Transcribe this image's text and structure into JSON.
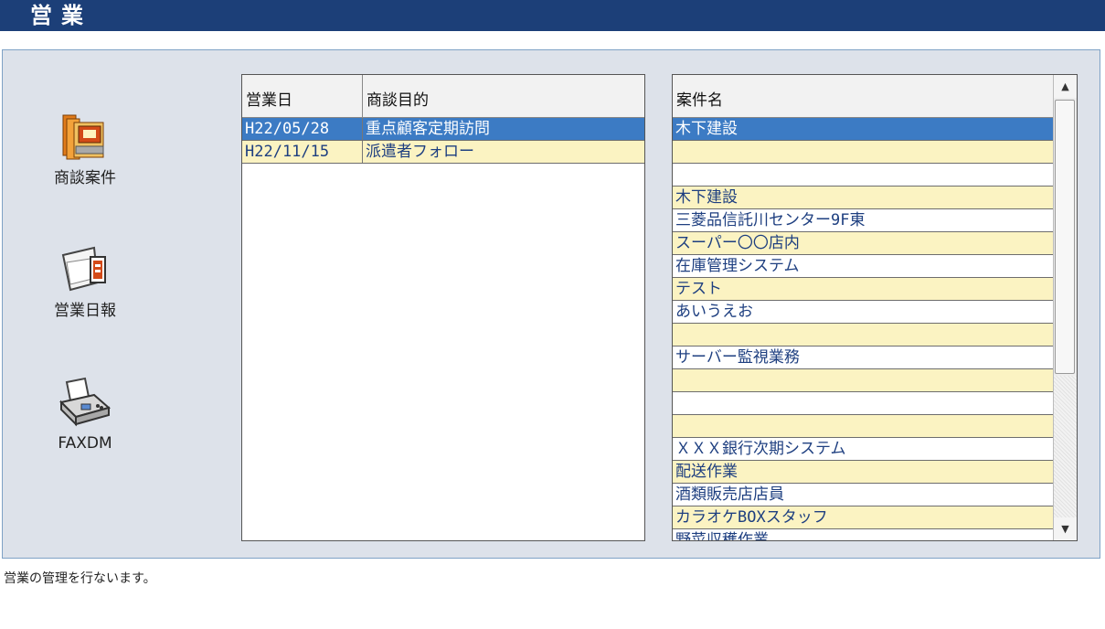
{
  "header": {
    "title": "営業"
  },
  "nav": {
    "items": [
      {
        "label": "商談案件",
        "icon": "folder-books-icon"
      },
      {
        "label": "営業日報",
        "icon": "report-document-icon"
      },
      {
        "label": "FAXDM",
        "icon": "fax-machine-icon"
      }
    ]
  },
  "sales_table": {
    "headers": [
      "営業日",
      "商談目的"
    ],
    "rows": [
      [
        "H22/05/28",
        "重点顧客定期訪問"
      ],
      [
        "H22/11/15",
        "派遣者フォロー"
      ]
    ],
    "selected_index": 0
  },
  "project_list": {
    "header": "案件名",
    "rows": [
      "木下建設",
      "",
      "",
      "木下建設",
      "三菱品信託川センター9F東",
      "スーパー〇〇店内",
      "在庫管理システム",
      "テスト",
      "あいうえお",
      "",
      "サーバー監視業務",
      "",
      "",
      "",
      "ＸＸＸ銀行次期システム",
      "配送作業",
      "酒類販売店店員",
      "カラオケBOXスタッフ",
      "野菜収穫作業"
    ],
    "row_colors": [
      "selected",
      "yellow",
      "white",
      "yellow",
      "white",
      "yellow",
      "white",
      "yellow",
      "white",
      "yellow",
      "white",
      "yellow",
      "white",
      "yellow",
      "white",
      "yellow",
      "white",
      "yellow",
      "white"
    ],
    "scrollbar": {
      "up_symbol": "▲",
      "down_symbol": "▼"
    }
  },
  "footer": {
    "description": "営業の管理を行ないます。"
  },
  "colors": {
    "title_bar": "#1c3f78",
    "panel": "#dde2ea",
    "selected_row": "#3c7bc4",
    "yellow_row": "#fbf3c2",
    "link_text": "#1e3f80"
  }
}
